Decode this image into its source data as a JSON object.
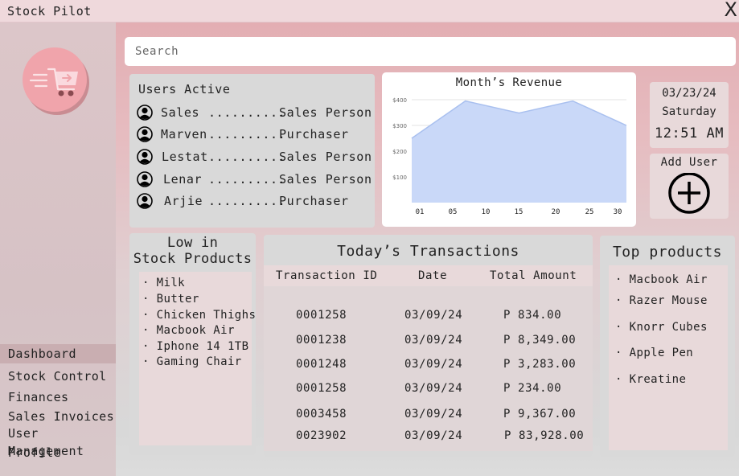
{
  "window": {
    "title": "Stock Pilot",
    "close_glyph": "X"
  },
  "search": {
    "placeholder": "Search",
    "value": ""
  },
  "sidebar": {
    "items": [
      {
        "label": "Dashboard",
        "active": true
      },
      {
        "label": "Stock Control",
        "active": false
      },
      {
        "label": "Finances",
        "active": false
      },
      {
        "label": "Sales Invoices",
        "active": false
      },
      {
        "label": "User Management",
        "active": false
      },
      {
        "label": "Profile",
        "active": false
      }
    ]
  },
  "users_active": {
    "heading": "Users Active",
    "users": [
      {
        "name": "Sales",
        "dots": "..........",
        "role": "Sales Person"
      },
      {
        "name": "Marven",
        "dots": "..........",
        "role": "Purchaser"
      },
      {
        "name": "Lestat",
        "dots": "..........",
        "role": "Sales Person"
      },
      {
        "name": "Lenar",
        "dots": "..........",
        "role": "Sales Person"
      },
      {
        "name": "Arjie",
        "dots": "..........",
        "role": "Purchaser"
      }
    ]
  },
  "revenue": {
    "heading": "Month’s Revenue"
  },
  "chart_data": {
    "type": "area",
    "title": "Month’s Revenue",
    "xlabel": "",
    "ylabel": "",
    "x_ticks": [
      "01",
      "05",
      "10",
      "15",
      "20",
      "25",
      "30"
    ],
    "y_ticks": [
      "$100",
      "$200",
      "$300",
      "$400"
    ],
    "x": [
      1,
      9,
      17,
      25,
      33
    ],
    "values": [
      250,
      395,
      348,
      395,
      300
    ],
    "xlim": [
      1,
      33
    ],
    "ylim": [
      0,
      400
    ],
    "grid": true,
    "color": "#c9d8f8",
    "line_color": "#a9c0ef"
  },
  "date_card": {
    "date": "03/23/24",
    "day": "Saturday",
    "time": "12:51 AM"
  },
  "add_user": {
    "label": "Add User"
  },
  "low_stock": {
    "heading_line1": "Low in",
    "heading_line2": "Stock Products",
    "items": [
      "Milk",
      "Butter",
      "Chicken Thighs",
      "Macbook Air",
      "Iphone 14 1TB",
      "Gaming Chair"
    ]
  },
  "transactions": {
    "heading": "Today’s Transactions",
    "columns": [
      "Transaction ID",
      "Date",
      "Total Amount"
    ],
    "rows": [
      {
        "id": "0001258",
        "date": "03/09/24",
        "amount": "P 834.00"
      },
      {
        "id": "0001238",
        "date": "03/09/24",
        "amount": "P 8,349.00"
      },
      {
        "id": "0001248",
        "date": "03/09/24",
        "amount": "P 3,283.00"
      },
      {
        "id": "0001258",
        "date": "03/09/24",
        "amount": "P 234.00"
      },
      {
        "id": "0003458",
        "date": "03/09/24",
        "amount": "P 9,367.00"
      },
      {
        "id": "0023902",
        "date": "03/09/24",
        "amount": "P 83,928.00"
      }
    ]
  },
  "top_products": {
    "heading": "Top products",
    "items": [
      "Macbook Air",
      "Razer Mouse",
      "Knorr Cubes",
      "Apple Pen",
      "Kreatine"
    ]
  },
  "colors": {
    "accent": "#f0a4ab",
    "panel": "#d9d9d9",
    "panel_inner": "#e8d9da",
    "header_gradient_top": "#e3aeb3"
  }
}
